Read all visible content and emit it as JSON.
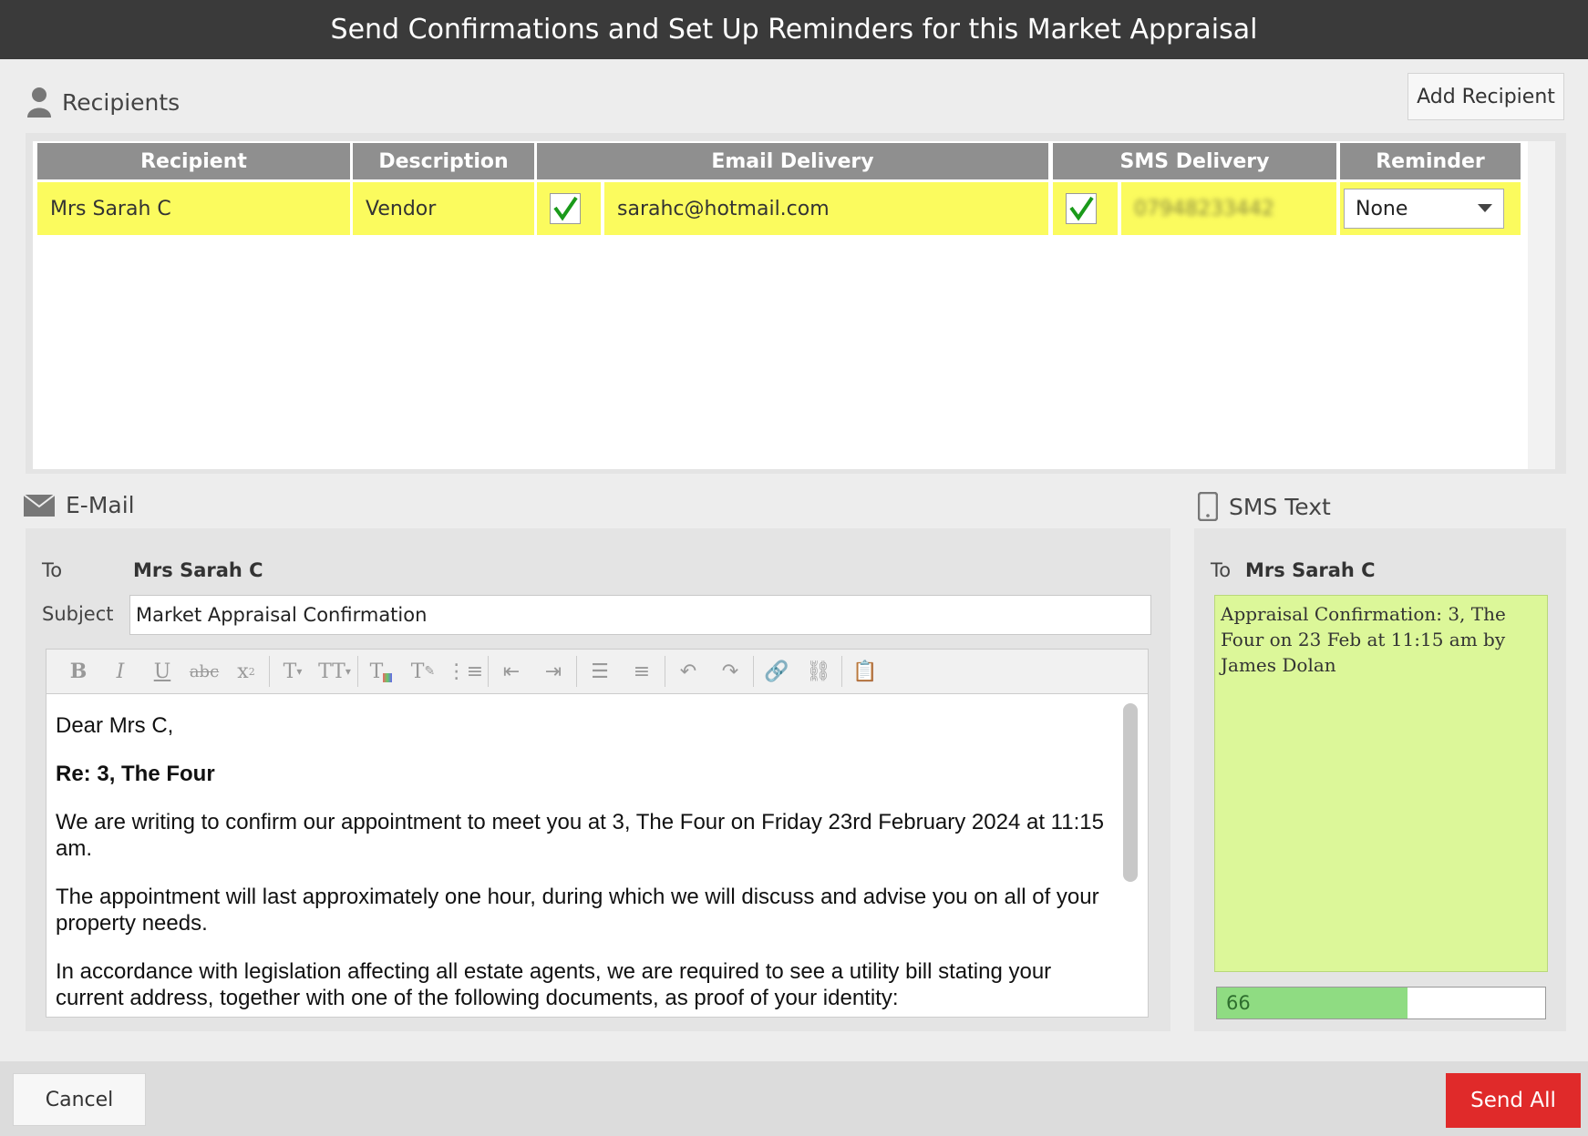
{
  "window": {
    "title": "Send Confirmations and Set Up Reminders for this Market Appraisal"
  },
  "recipients": {
    "heading": "Recipients",
    "add_button": "Add Recipient",
    "columns": [
      "Recipient",
      "Description",
      "Email Delivery",
      "SMS Delivery",
      "Reminder"
    ],
    "rows": [
      {
        "recipient": "Mrs Sarah C",
        "description": "Vendor",
        "email_checked": true,
        "email": "sarahc@hotmail.com",
        "sms_checked": true,
        "sms_number": "07948233442",
        "reminder": "None"
      }
    ]
  },
  "email": {
    "heading": "E-Mail",
    "to_label": "To",
    "to_value": "Mrs Sarah C",
    "subject_label": "Subject",
    "subject_value": "Market Appraisal Confirmation",
    "body": {
      "greeting": "Dear Mrs C,",
      "re_line": "Re: 3, The Four",
      "para1": "We are writing to confirm our appointment to meet you at 3, The Four on Friday 23rd February 2024 at 11:15 am.",
      "para2": "The appointment will last approximately one hour, during which we will discuss and advise you on all of your property needs.",
      "para3": "In accordance with legislation affecting all estate agents, we are required to see a utility bill stating your current address, together with one of the following documents, as proof of your identity:"
    }
  },
  "sms": {
    "heading": "SMS Text",
    "to_label": "To",
    "to_value": "Mrs Sarah C",
    "message": "Appraisal Confirmation: 3, The Four on 23 Feb at 11:15 am by James Dolan",
    "char_count": "66",
    "char_fill_fraction": 0.58
  },
  "footer": {
    "cancel": "Cancel",
    "send_all": "Send All"
  },
  "colors": {
    "selected_row": "#fbfb5e",
    "sms_bg": "#dcf799",
    "send_button": "#e02a2a"
  }
}
